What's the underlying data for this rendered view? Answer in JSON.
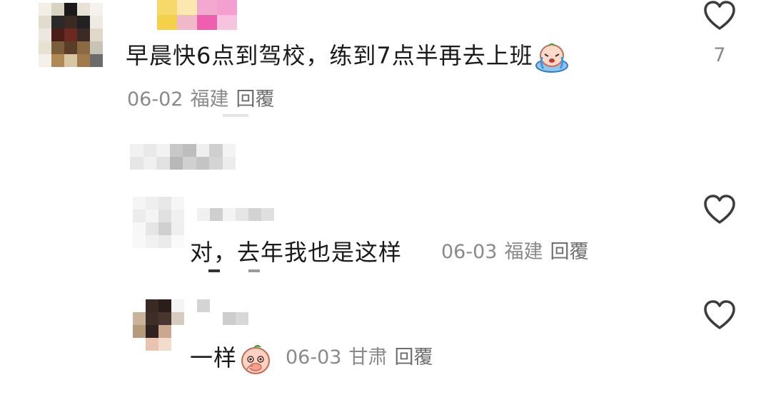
{
  "comments": [
    {
      "text": "早晨快6点到驾校，练到7点半再去上班",
      "emoji": "crying-emoji",
      "date": "06-02",
      "location": "福建",
      "reply_label": "回覆",
      "likes": "7"
    },
    {
      "text": "对，去年我也是这样",
      "date": "06-03",
      "location": "福建",
      "reply_label": "回覆"
    },
    {
      "text": "一样",
      "emoji": "peach-emoji",
      "date": "06-03",
      "location": "甘肃",
      "reply_label": "回覆"
    }
  ],
  "colors": {
    "text": "#1a1a1a",
    "meta": "#8a8a8a",
    "heart_stroke": "#3c3c3c"
  }
}
